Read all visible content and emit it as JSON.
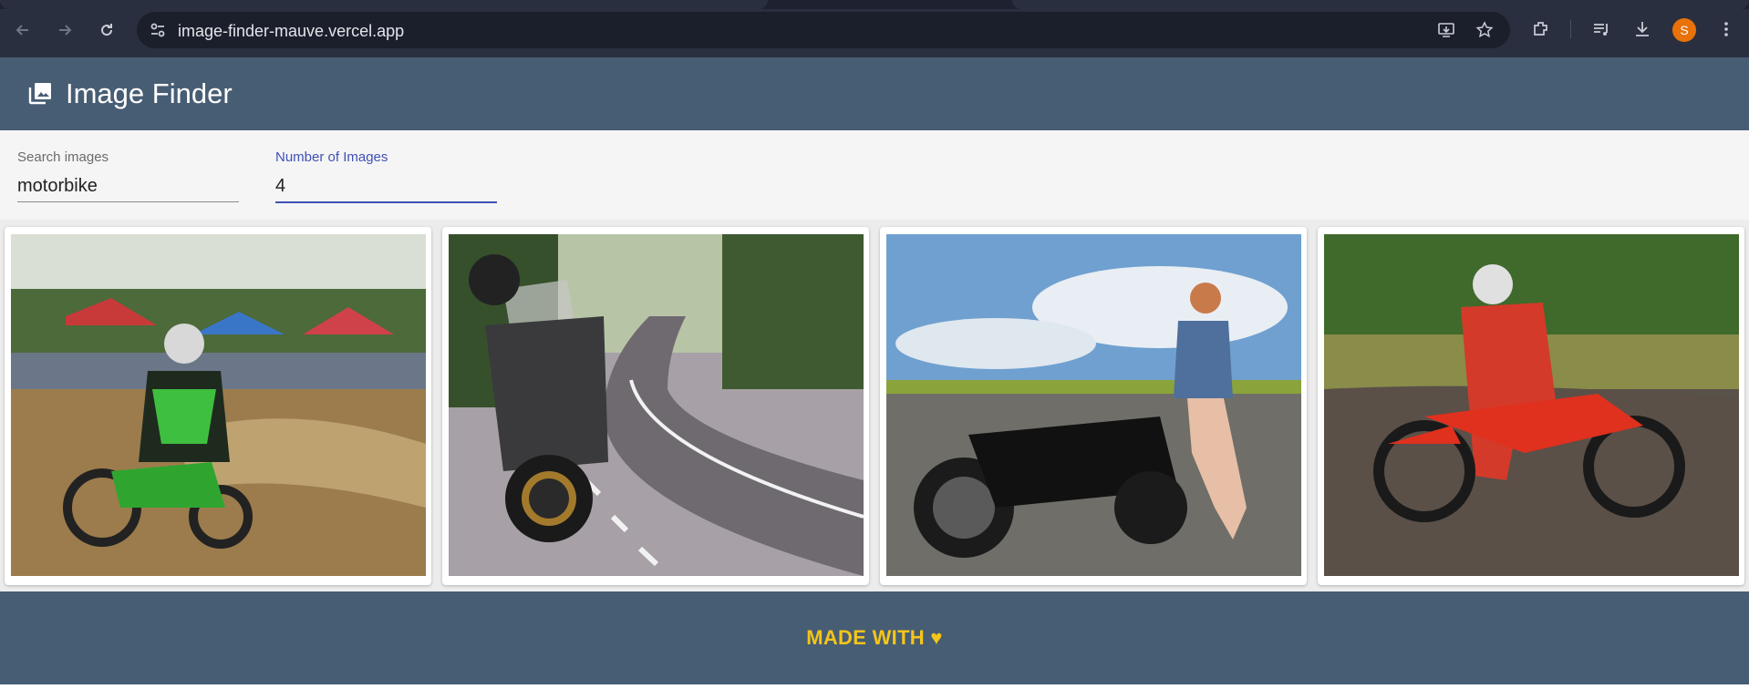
{
  "browser": {
    "url": "image-finder-mauve.vercel.app",
    "avatar_initial": "S",
    "icons": [
      "back-icon",
      "forward-icon",
      "reload-icon",
      "site-info-icon",
      "install-app-icon",
      "bookmark-star-icon",
      "extensions-icon",
      "media-control-icon",
      "downloads-icon",
      "menu-kebab-icon"
    ]
  },
  "header": {
    "title": "Image Finder",
    "logo_icon": "photo-library-icon",
    "background": "#475d74"
  },
  "form": {
    "search": {
      "label": "Search images",
      "value": "motorbike"
    },
    "count": {
      "label": "Number of Images",
      "value": "4"
    },
    "accent": "#3f51b5"
  },
  "gallery": {
    "images": [
      {
        "subject": "motocross rider in green cornering on dirt"
      },
      {
        "subject": "adventure motorcycle parked on curving road"
      },
      {
        "subject": "woman sitting on black cruiser motorcycle"
      },
      {
        "subject": "rider in red on red dirt bike in mud"
      }
    ]
  },
  "footer": {
    "text": "MADE WITH",
    "heart": "♥",
    "color": "#f5c518"
  }
}
